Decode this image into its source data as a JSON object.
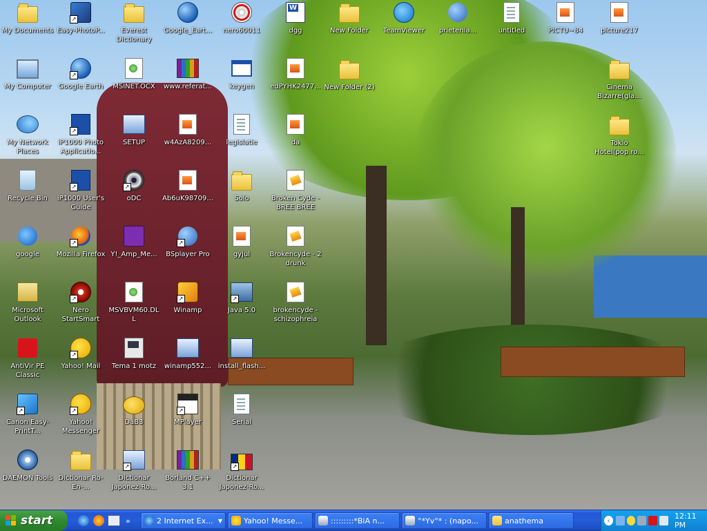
{
  "desktop_icons": [
    {
      "label": "My Documents",
      "glyph": "folder-documents-icon",
      "shortcut": false
    },
    {
      "label": "My Computer",
      "glyph": "computer-icon",
      "shortcut": false
    },
    {
      "label": "My Network Places",
      "glyph": "network-icon",
      "shortcut": false
    },
    {
      "label": "Recycle Bin",
      "glyph": "recycle-bin-icon",
      "shortcut": false
    },
    {
      "label": "google",
      "glyph": "ie-icon",
      "shortcut": false
    },
    {
      "label": "Microsoft Outlook",
      "glyph": "outlook-icon",
      "shortcut": false
    },
    {
      "label": "AntiVir PE Classic",
      "glyph": "antivir-icon",
      "shortcut": false
    },
    {
      "label": "Canon Easy-PrintT...",
      "glyph": "canon-icon",
      "shortcut": true
    },
    {
      "label": "DAEMON Tools",
      "glyph": "daemon-tools-icon",
      "shortcut": false
    },
    {
      "label": "Easy-PhotoP...",
      "glyph": "photo-icon",
      "shortcut": true
    },
    {
      "label": "Google Earth",
      "glyph": "google-earth-icon",
      "shortcut": true
    },
    {
      "label": "iP1000 Photo Applicatio...",
      "glyph": "help-icon",
      "shortcut": true
    },
    {
      "label": "iP1000 User's Guide",
      "glyph": "help-icon",
      "shortcut": true
    },
    {
      "label": "Mozilla Firefox",
      "glyph": "firefox-icon",
      "shortcut": true
    },
    {
      "label": "Nero StartSmart",
      "glyph": "nero-icon",
      "shortcut": true
    },
    {
      "label": "Yahoo! Mail",
      "glyph": "yahoo-mail-icon",
      "shortcut": true
    },
    {
      "label": "Yahoo! Messenger",
      "glyph": "yahoo-messenger-icon",
      "shortcut": true
    },
    {
      "label": "Dictionar Ro-En-...",
      "glyph": "folder-icon",
      "shortcut": false
    },
    {
      "label": "Everest Dictionary",
      "glyph": "folder-icon",
      "shortcut": false
    },
    {
      "label": "MSINET.OCX",
      "glyph": "dll-icon",
      "shortcut": false
    },
    {
      "label": "SETUP",
      "glyph": "setup-icon",
      "shortcut": false
    },
    {
      "label": "oDC",
      "glyph": "eye-icon",
      "shortcut": true
    },
    {
      "label": "Y!_Amp_Me...",
      "glyph": "yahoo-amp-icon",
      "shortcut": false
    },
    {
      "label": "MSVBVM60.DLL",
      "glyph": "dll-icon",
      "shortcut": false
    },
    {
      "label": "Tema 1 motz",
      "glyph": "batch-icon",
      "shortcut": false
    },
    {
      "label": "DaB3",
      "glyph": "fish-icon",
      "shortcut": false
    },
    {
      "label": "Dictionar Japonez-Ro...",
      "glyph": "setup-icon",
      "shortcut": true
    },
    {
      "label": "Google_Eart...",
      "glyph": "google-earth-icon",
      "shortcut": false
    },
    {
      "label": "www.referat...",
      "glyph": "winrar-icon",
      "shortcut": false
    },
    {
      "label": "w4AzA8209...",
      "glyph": "image-icon",
      "shortcut": false
    },
    {
      "label": "Ab6uK98709...",
      "glyph": "image-icon",
      "shortcut": false
    },
    {
      "label": "BSplayer Pro",
      "glyph": "bsplayer-icon",
      "shortcut": true
    },
    {
      "label": "Winamp",
      "glyph": "winamp-icon",
      "shortcut": true
    },
    {
      "label": "winamp552...",
      "glyph": "setup-icon",
      "shortcut": false
    },
    {
      "label": "MPlayer",
      "glyph": "mplayer-icon",
      "shortcut": true
    },
    {
      "label": "Borland C++ 3.1",
      "glyph": "winrar-icon",
      "shortcut": false
    },
    {
      "label": "nero60011",
      "glyph": "nero-cd-icon",
      "shortcut": false
    },
    {
      "label": "keygen",
      "glyph": "keygen-icon",
      "shortcut": false
    },
    {
      "label": "legislatie",
      "glyph": "document-icon",
      "shortcut": false
    },
    {
      "label": "Solo",
      "glyph": "folder-icon",
      "shortcut": false
    },
    {
      "label": "gyjul",
      "glyph": "image-icon",
      "shortcut": false
    },
    {
      "label": "Java 5.0",
      "glyph": "java-icon",
      "shortcut": true
    },
    {
      "label": "install_flash...",
      "glyph": "setup-icon",
      "shortcut": false
    },
    {
      "label": "Serial",
      "glyph": "document-icon",
      "shortcut": false
    },
    {
      "label": "Dictionar Japonez-Ro...",
      "glyph": "flag-icon",
      "shortcut": true
    },
    {
      "label": "dgg",
      "glyph": "word-icon",
      "shortcut": false
    },
    {
      "label": "edPYHK2477...",
      "glyph": "image-icon",
      "shortcut": false
    },
    {
      "label": "da",
      "glyph": "image-icon",
      "shortcut": false
    },
    {
      "label": "Broken Cyde - BREE BREE",
      "glyph": "brokencyde-icon",
      "shortcut": false
    },
    {
      "label": "Brokencyde - 2 drunk",
      "glyph": "brokencyde-icon",
      "shortcut": false
    },
    {
      "label": "brokencyde - schizophreia",
      "glyph": "brokencyde-icon",
      "shortcut": false
    },
    {
      "label": "New Folder",
      "glyph": "folder-icon",
      "shortcut": false
    },
    {
      "label": "New Folder (2)",
      "glyph": "folder-icon",
      "shortcut": false
    },
    {
      "label": "TeamViewer",
      "glyph": "teamviewer-icon",
      "shortcut": false
    },
    {
      "label": "prietenia...",
      "glyph": "bsplayer-icon",
      "shortcut": false
    },
    {
      "label": "untitled",
      "glyph": "document-icon",
      "shortcut": false
    },
    {
      "label": "PICTU~84",
      "glyph": "image-icon",
      "shortcut": false
    },
    {
      "label": "picture217",
      "glyph": "image-icon",
      "shortcut": false
    },
    {
      "label": "Cinema Bizarre(gla...",
      "glyph": "folder-icon",
      "shortcut": false
    },
    {
      "label": "Tokio Hotel(pop.ro...",
      "glyph": "folder-icon",
      "shortcut": false
    }
  ],
  "taskbar": {
    "start_label": "start",
    "tasks": [
      {
        "label": "2 Internet Ex...",
        "icon": "ie-icon",
        "dropdown": true
      },
      {
        "label": "Yahoo! Messe...",
        "icon": "yahoo-messenger-icon",
        "dropdown": false
      },
      {
        "label": ":::::::::*BiA n...",
        "icon": "chat-icon",
        "dropdown": false
      },
      {
        "label": "°*Yv°* : (napo...",
        "icon": "chat-icon",
        "dropdown": false
      },
      {
        "label": "anathema",
        "icon": "folder-icon",
        "dropdown": false
      }
    ],
    "clock": "12:11 PM"
  }
}
